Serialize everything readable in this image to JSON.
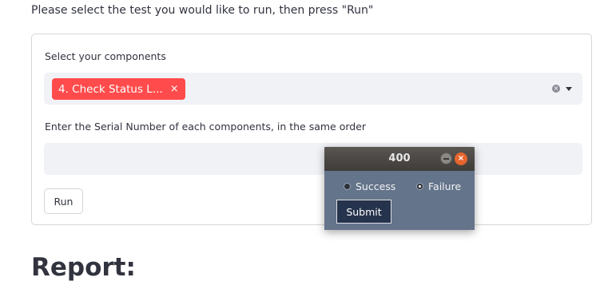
{
  "instructions": "Please select the test you would like to run, then press \"Run\"",
  "form": {
    "components_label": "Select your components",
    "selected_tag": "4. Check Status L...",
    "tag_remove": "×",
    "clear": "×",
    "serial_label": "Enter the Serial Number of each components, in the same order",
    "serial_value": "",
    "run_label": "Run"
  },
  "report_heading": "Report:",
  "dialog": {
    "title": "400",
    "close": "×",
    "options": [
      "Success",
      "Failure"
    ],
    "selected_option": "Failure",
    "submit_label": "Submit"
  },
  "colors": {
    "accent": "#ff4b4b",
    "input_bg": "#f0f2f6",
    "dialog_bg": "#64748b",
    "submit_bg": "#26334d",
    "close_button": "#e5652d"
  }
}
